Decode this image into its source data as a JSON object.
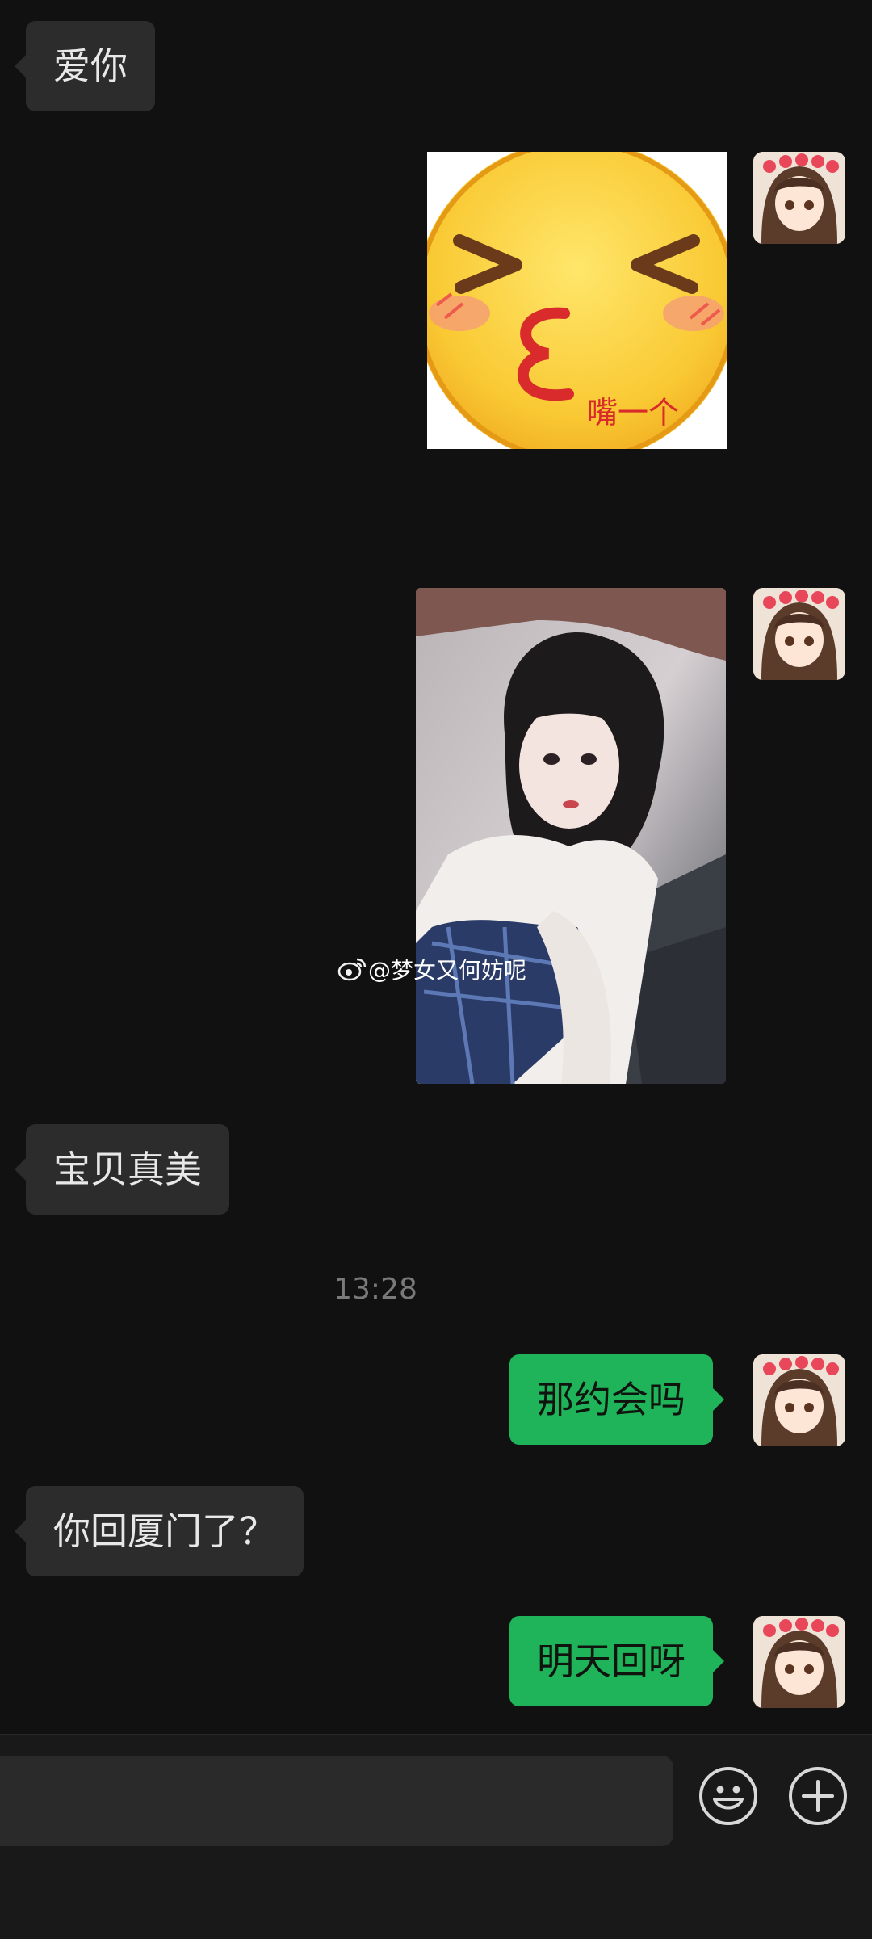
{
  "messages": {
    "m1": "爱你",
    "sticker_caption": "嘴一个",
    "photo_watermark": "@梦女又何妨呢",
    "m2": "宝贝真美",
    "timestamp": "13:28",
    "m3": "那约会吗",
    "m4": "你回厦门了？",
    "m5": "明天回呀"
  },
  "icons": {
    "sticker": "kiss-face-emoji",
    "watermark": "weibo-icon",
    "emoji_button": "smiley-icon",
    "plus_button": "plus-icon"
  },
  "colors": {
    "background": "#111111",
    "incoming_bubble": "#2c2c2c",
    "outgoing_bubble": "#20b45a"
  }
}
